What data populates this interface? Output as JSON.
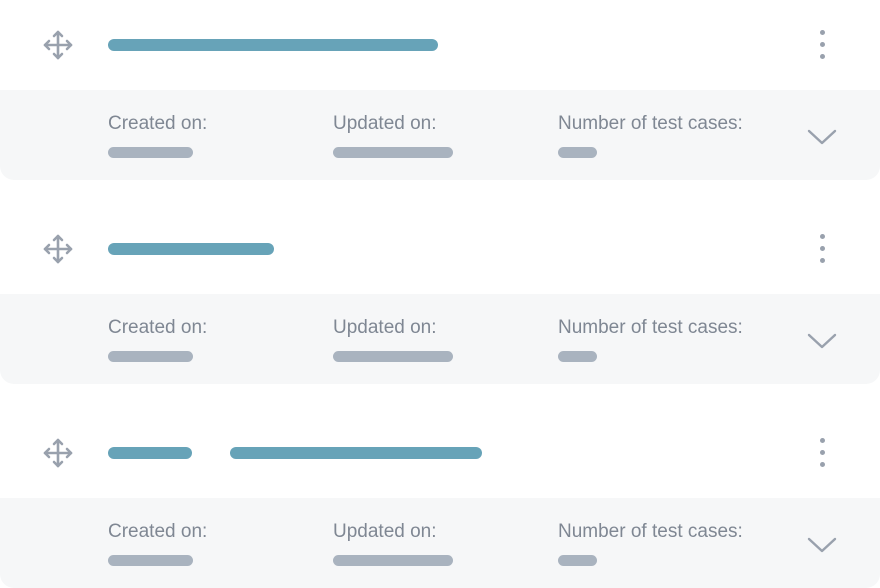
{
  "items": [
    {
      "drag_icon": "move-arrows-icon",
      "menu_icon": "kebab-menu-icon",
      "expand_icon": "chevron-down-icon",
      "created_label": "Created on:",
      "updated_label": "Updated on:",
      "count_label": "Number of test cases:"
    },
    {
      "drag_icon": "move-arrows-icon",
      "menu_icon": "kebab-menu-icon",
      "expand_icon": "chevron-down-icon",
      "created_label": "Created on:",
      "updated_label": "Updated on:",
      "count_label": "Number of test cases:"
    },
    {
      "drag_icon": "move-arrows-icon",
      "menu_icon": "kebab-menu-icon",
      "expand_icon": "chevron-down-icon",
      "created_label": "Created on:",
      "updated_label": "Updated on:",
      "count_label": "Number of test cases:"
    }
  ],
  "colors": {
    "title_placeholder": "#67a3b8",
    "meta_placeholder": "#a9b3bf",
    "meta_background": "#f6f7f8",
    "label_text": "#7f8793",
    "icon": "#99a1ad"
  }
}
